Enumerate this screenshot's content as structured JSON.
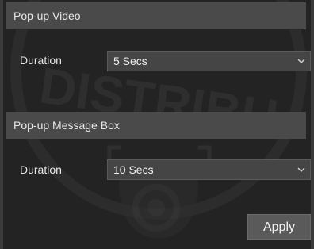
{
  "popup_video": {
    "header": "Pop-up Video",
    "duration_label": "Duration",
    "duration_value": "5 Secs"
  },
  "popup_message": {
    "header": "Pop-up Message Box",
    "duration_label": "Duration",
    "duration_value": "10 Secs"
  },
  "actions": {
    "apply_label": "Apply"
  },
  "watermark": {
    "text": "DISTRIBU"
  },
  "icons": {
    "dropdown": "chevron-down-icon",
    "watermark_camera": "dome-camera-icon"
  },
  "colors": {
    "background": "#232323",
    "header_bar": "#4a4a4a",
    "select_bg": "#454545",
    "button_bg": "#5a5a5a"
  }
}
